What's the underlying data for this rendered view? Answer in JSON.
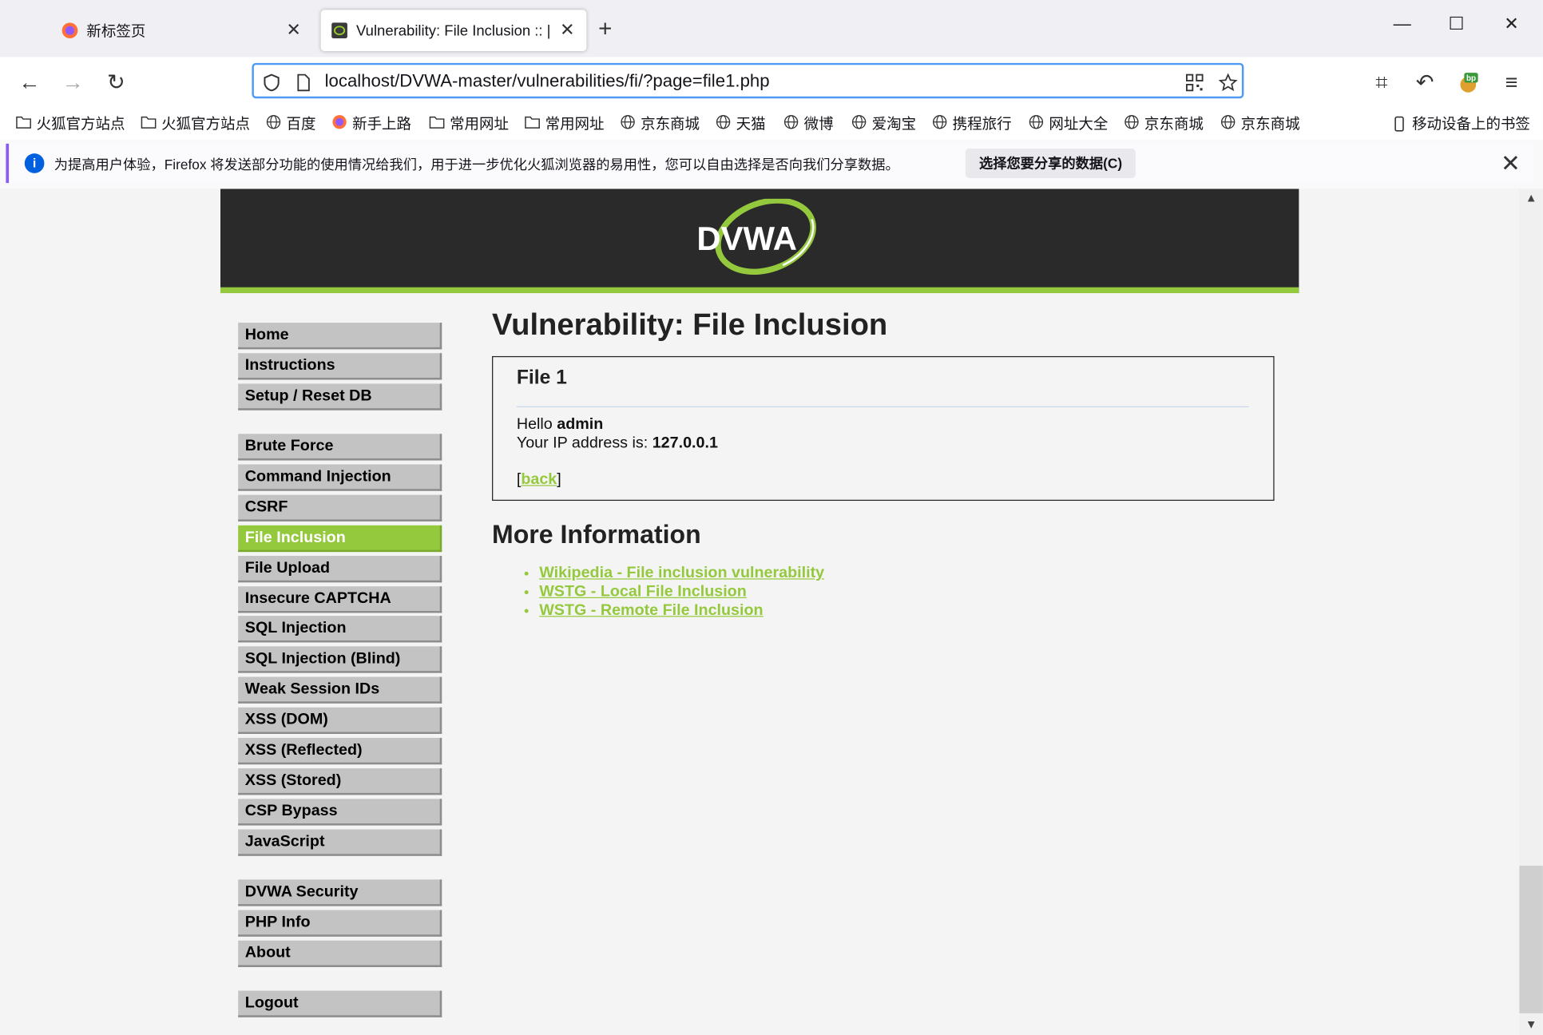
{
  "tabs": [
    {
      "label": "新标签页",
      "active": false
    },
    {
      "label": "Vulnerability: File Inclusion :: |",
      "active": true
    }
  ],
  "nav": {
    "url": "localhost/DVWA-master/vulnerabilities/fi/?page=file1.php"
  },
  "bookmarks": [
    {
      "label": "火狐官方站点",
      "icon": "folder-icon"
    },
    {
      "label": "火狐官方站点",
      "icon": "folder-icon"
    },
    {
      "label": "百度",
      "icon": "globe-icon"
    },
    {
      "label": "新手上路",
      "icon": "firefox-icon"
    },
    {
      "label": "常用网址",
      "icon": "folder-icon"
    },
    {
      "label": "常用网址",
      "icon": "folder-icon"
    },
    {
      "label": "京东商城",
      "icon": "globe-icon"
    },
    {
      "label": "天猫",
      "icon": "globe-icon"
    },
    {
      "label": "微博",
      "icon": "globe-icon"
    },
    {
      "label": "爱淘宝",
      "icon": "globe-icon"
    },
    {
      "label": "携程旅行",
      "icon": "globe-icon"
    },
    {
      "label": "网址大全",
      "icon": "globe-icon"
    },
    {
      "label": "京东商城",
      "icon": "globe-icon"
    },
    {
      "label": "京东商城",
      "icon": "globe-icon"
    }
  ],
  "mobile_bookmarks": "移动设备上的书签",
  "notification": {
    "message": "为提高用户体验，Firefox 将发送部分功能的使用情况给我们，用于进一步优化火狐浏览器的易用性，您可以自由选择是否向我们分享数据。",
    "action": "选择您要分享的数据(C)"
  },
  "dvwa": {
    "logo_text": "DVWA",
    "menu_groups": [
      [
        "Home",
        "Instructions",
        "Setup / Reset DB"
      ],
      [
        "Brute Force",
        "Command Injection",
        "CSRF",
        "File Inclusion",
        "File Upload",
        "Insecure CAPTCHA",
        "SQL Injection",
        "SQL Injection (Blind)",
        "Weak Session IDs",
        "XSS (DOM)",
        "XSS (Reflected)",
        "XSS (Stored)",
        "CSP Bypass",
        "JavaScript"
      ],
      [
        "DVWA Security",
        "PHP Info",
        "About"
      ],
      [
        "Logout"
      ]
    ],
    "selected_menu": "File Inclusion",
    "page_title": "Vulnerability: File Inclusion",
    "file_box": {
      "heading": "File 1",
      "hello": "Hello ",
      "user": "admin",
      "ip_label": "Your IP address is: ",
      "ip": "127.0.0.1",
      "back": "back"
    },
    "more_info_title": "More Information",
    "more_info_links": [
      "Wikipedia - File inclusion vulnerability",
      "WSTG - Local File Inclusion",
      "WSTG - Remote File Inclusion"
    ]
  },
  "colors": {
    "accent": "#95c93d",
    "header_bg": "#2a2a2a",
    "menu_bg": "#c3c3c3",
    "url_focus": "#4e9af5"
  }
}
